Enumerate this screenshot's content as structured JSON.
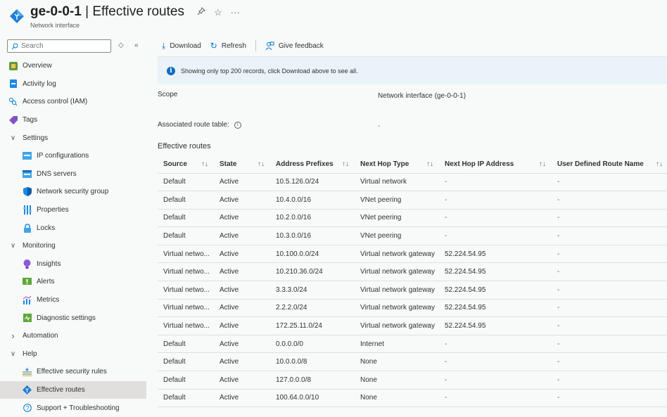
{
  "header": {
    "resource_name": "ge-0-0-1",
    "page_name": "Effective routes",
    "separator": " | ",
    "subtitle": "Network interface",
    "pin_icon": "☆",
    "more_icon": "···"
  },
  "sidebar": {
    "search_placeholder": "Search",
    "items": [
      {
        "label": "Overview",
        "icon": "overview-icon",
        "level": 0
      },
      {
        "label": "Activity log",
        "icon": "activity-log-icon",
        "level": 0
      },
      {
        "label": "Access control (IAM)",
        "icon": "iam-icon",
        "level": 0
      },
      {
        "label": "Tags",
        "icon": "tag-icon",
        "level": 0
      },
      {
        "label": "Settings",
        "icon": "chevron-down-icon",
        "level": "group",
        "expanded": true
      },
      {
        "label": "IP configurations",
        "icon": "ip-config-icon",
        "level": 1
      },
      {
        "label": "DNS servers",
        "icon": "dns-icon",
        "level": 1
      },
      {
        "label": "Network security group",
        "icon": "shield-icon",
        "level": 1
      },
      {
        "label": "Properties",
        "icon": "properties-icon",
        "level": 1
      },
      {
        "label": "Locks",
        "icon": "lock-icon",
        "level": 1
      },
      {
        "label": "Monitoring",
        "icon": "chevron-down-icon",
        "level": "group",
        "expanded": true
      },
      {
        "label": "Insights",
        "icon": "insights-icon",
        "level": 1
      },
      {
        "label": "Alerts",
        "icon": "alerts-icon",
        "level": 1
      },
      {
        "label": "Metrics",
        "icon": "metrics-icon",
        "level": 1
      },
      {
        "label": "Diagnostic settings",
        "icon": "diagnostic-icon",
        "level": 1
      },
      {
        "label": "Automation",
        "icon": "chevron-right-icon",
        "level": "group",
        "expanded": false
      },
      {
        "label": "Help",
        "icon": "chevron-down-icon",
        "level": "group",
        "expanded": true
      },
      {
        "label": "Effective security rules",
        "icon": "security-rules-icon",
        "level": 1
      },
      {
        "label": "Effective routes",
        "icon": "routes-icon",
        "level": 1,
        "active": true
      },
      {
        "label": "Support + Troubleshooting",
        "icon": "help-icon",
        "level": 1
      }
    ]
  },
  "toolbar": {
    "download_label": "Download",
    "refresh_label": "Refresh",
    "feedback_label": "Give feedback"
  },
  "info": {
    "message": "Showing only top 200 records, click Download above to see all."
  },
  "details": {
    "scope_label": "Scope",
    "scope_value": "Network interface (ge-0-0-1)",
    "route_table_label": "Associated route table:",
    "route_table_value": "-"
  },
  "routes": {
    "title": "Effective routes",
    "columns": [
      "Source",
      "State",
      "Address Prefixes",
      "Next Hop Type",
      "Next Hop IP Address",
      "User Defined Route Name"
    ],
    "sort_glyph": "↑↓",
    "rows": [
      [
        "Default",
        "Active",
        "10.5.126.0/24",
        "Virtual network",
        "-",
        "-"
      ],
      [
        "Default",
        "Active",
        "10.4.0.0/16",
        "VNet peering",
        "-",
        "-"
      ],
      [
        "Default",
        "Active",
        "10.2.0.0/16",
        "VNet peering",
        "-",
        "-"
      ],
      [
        "Default",
        "Active",
        "10.3.0.0/16",
        "VNet peering",
        "-",
        "-"
      ],
      [
        "Virtual netwo...",
        "Active",
        "10.100.0.0/24",
        "Virtual network gateway",
        "52.224.54.95",
        "-"
      ],
      [
        "Virtual netwo...",
        "Active",
        "10.210.36.0/24",
        "Virtual network gateway",
        "52.224.54.95",
        "-"
      ],
      [
        "Virtual netwo...",
        "Active",
        "3.3.3.0/24",
        "Virtual network gateway",
        "52.224.54.95",
        "-"
      ],
      [
        "Virtual netwo...",
        "Active",
        "2.2.2.0/24",
        "Virtual network gateway",
        "52.224.54.95",
        "-"
      ],
      [
        "Virtual netwo...",
        "Active",
        "172.25.11.0/24",
        "Virtual network gateway",
        "52.224.54.95",
        "-"
      ],
      [
        "Default",
        "Active",
        "0.0.0.0/0",
        "Internet",
        "-",
        "-"
      ],
      [
        "Default",
        "Active",
        "10.0.0.0/8",
        "None",
        "-",
        "-"
      ],
      [
        "Default",
        "Active",
        "127.0.0.0/8",
        "None",
        "-",
        "-"
      ],
      [
        "Default",
        "Active",
        "100.64.0.0/10",
        "None",
        "-",
        "-"
      ]
    ]
  },
  "colors": {
    "accent": "#0078d4",
    "info_bg": "#e9f3f9",
    "active_nav": "#e1dfdd"
  }
}
